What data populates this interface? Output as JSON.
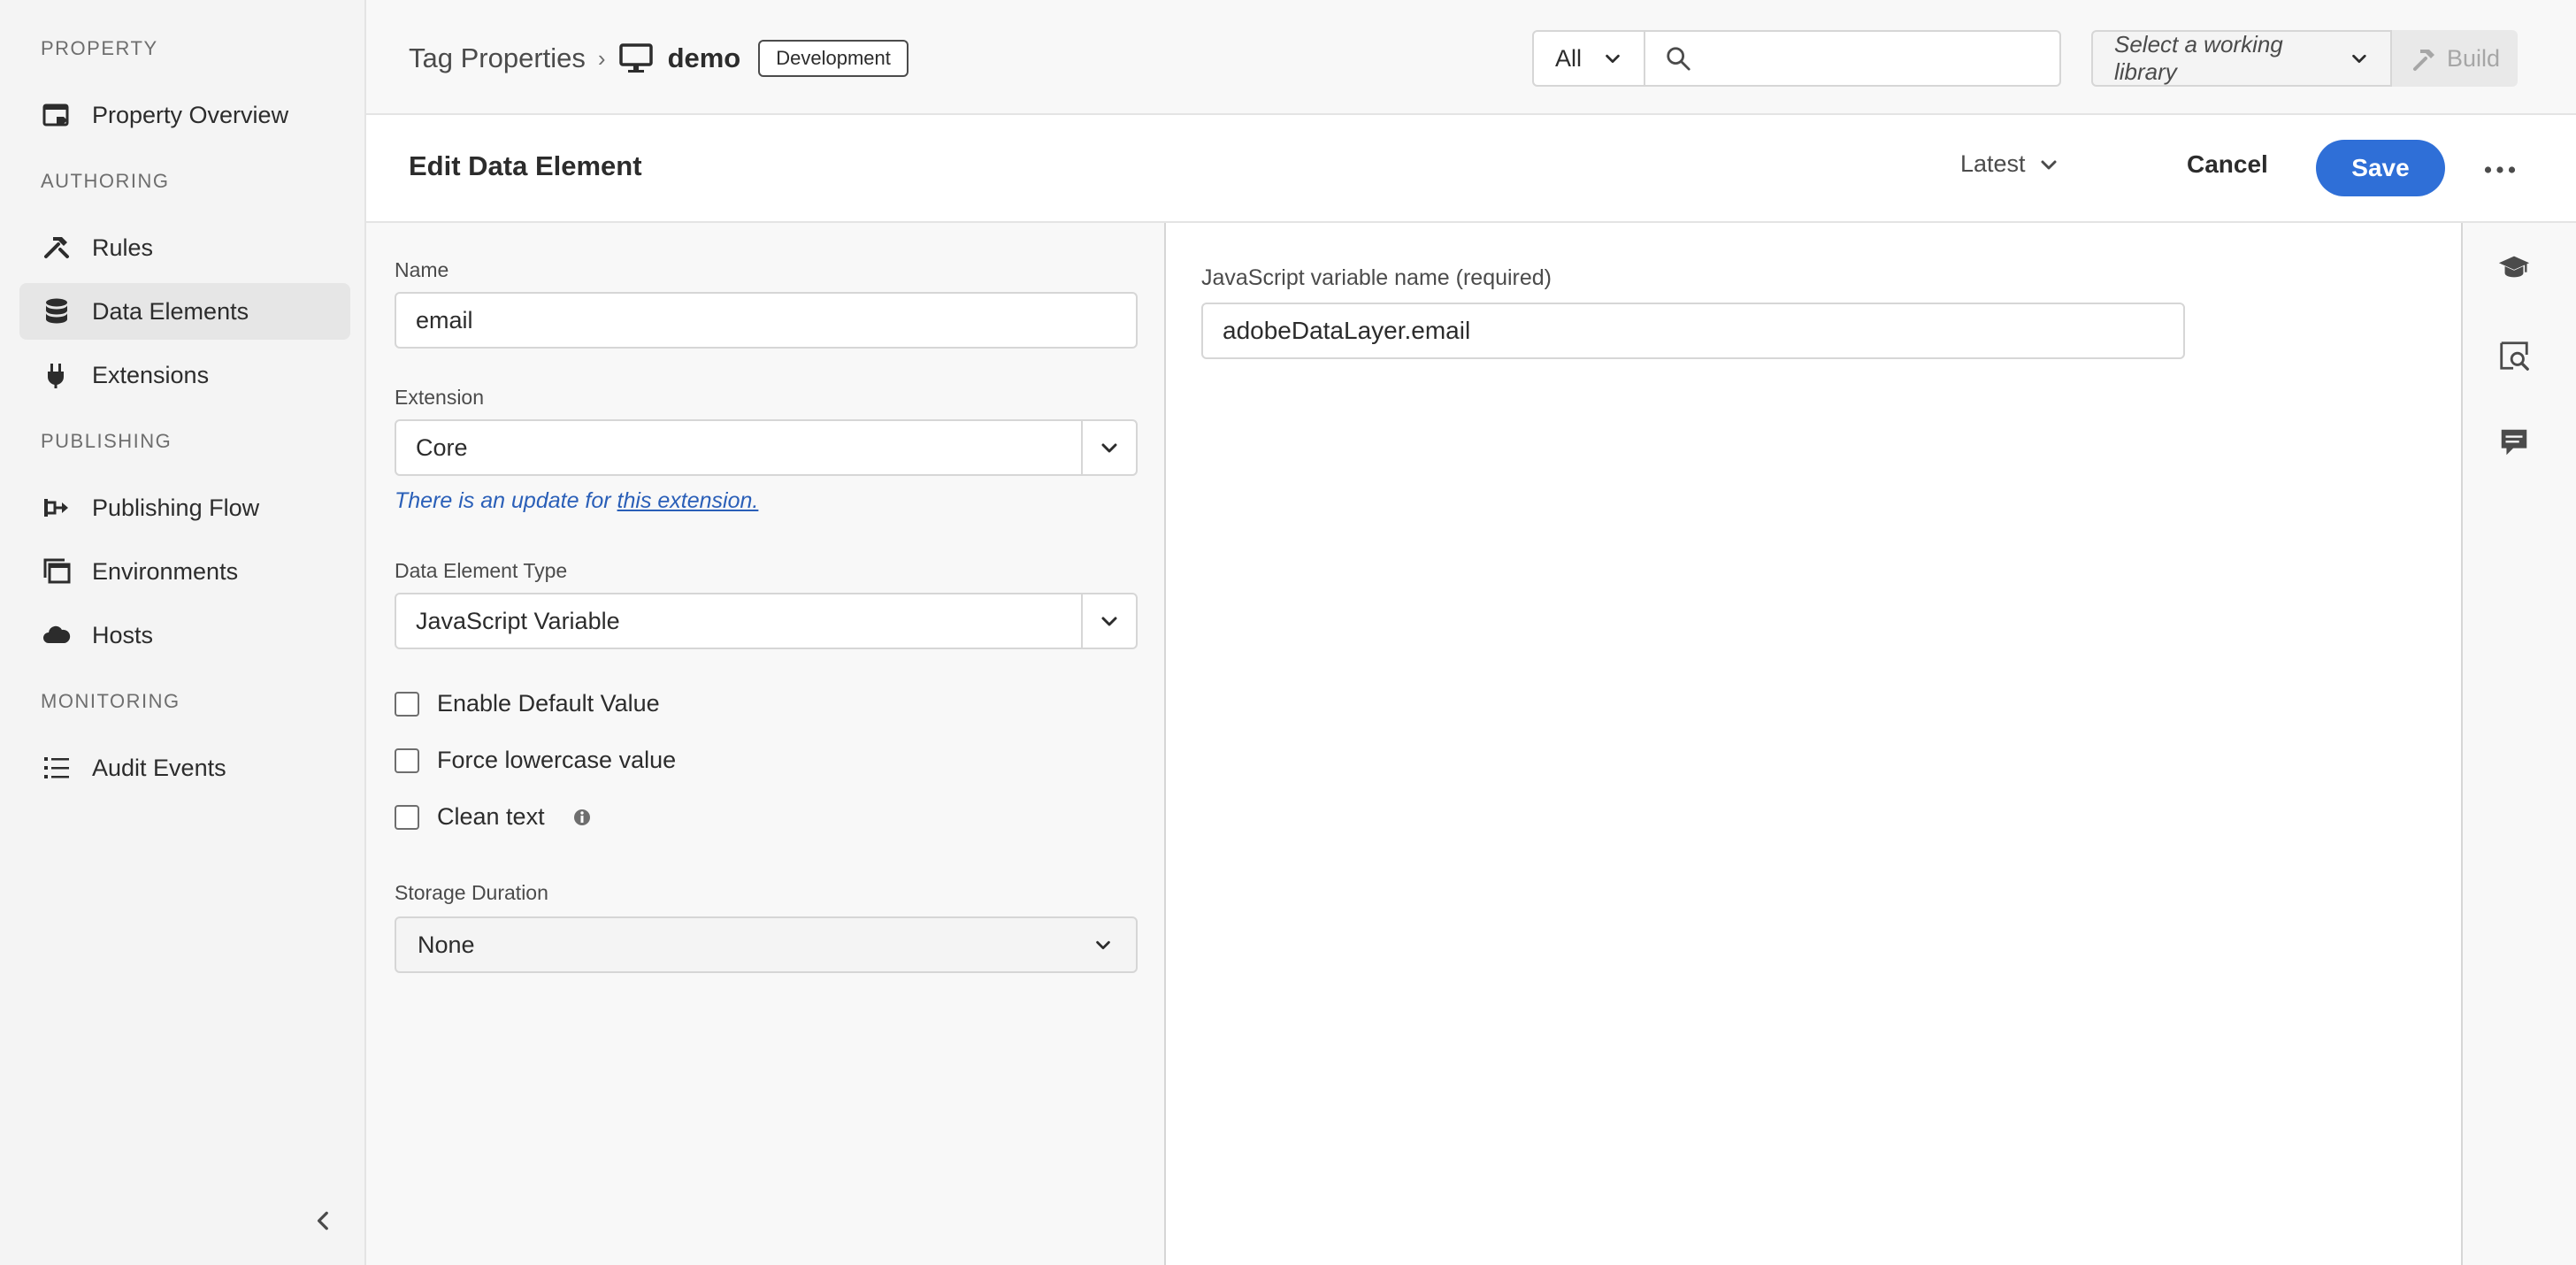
{
  "sidebar": {
    "sections": {
      "property": "PROPERTY",
      "authoring": "AUTHORING",
      "publishing": "PUBLISHING",
      "monitoring": "MONITORING"
    },
    "items": {
      "property_overview": "Property Overview",
      "rules": "Rules",
      "data_elements": "Data Elements",
      "extensions": "Extensions",
      "publishing_flow": "Publishing Flow",
      "environments": "Environments",
      "hosts": "Hosts",
      "audit_events": "Audit Events"
    },
    "active_item": "Data Elements"
  },
  "header": {
    "breadcrumb_root": "Tag Properties",
    "property_name": "demo",
    "environment_badge": "Development",
    "search_scope": "All",
    "search_value": "",
    "library_placeholder": "Select a working library",
    "build_label": "Build"
  },
  "subheader": {
    "title": "Edit Data Element",
    "version": "Latest",
    "cancel_label": "Cancel",
    "save_label": "Save"
  },
  "form": {
    "name_label": "Name",
    "name_value": "email",
    "extension_label": "Extension",
    "extension_value": "Core",
    "update_note_prefix": "There is an update for ",
    "update_note_link": "this extension.",
    "type_label": "Data Element Type",
    "type_value": "JavaScript Variable",
    "checkboxes": {
      "enable_default": {
        "label": "Enable Default Value",
        "checked": false
      },
      "force_lowercase": {
        "label": "Force lowercase value",
        "checked": false
      },
      "clean_text": {
        "label": "Clean text",
        "checked": false
      }
    },
    "storage_label": "Storage Duration",
    "storage_value": "None"
  },
  "settings": {
    "js_var_label": "JavaScript variable name (required)",
    "js_var_value": "adobeDataLayer.email"
  },
  "colors": {
    "accent": "#2f6fd7",
    "link": "#2a5fb8"
  }
}
